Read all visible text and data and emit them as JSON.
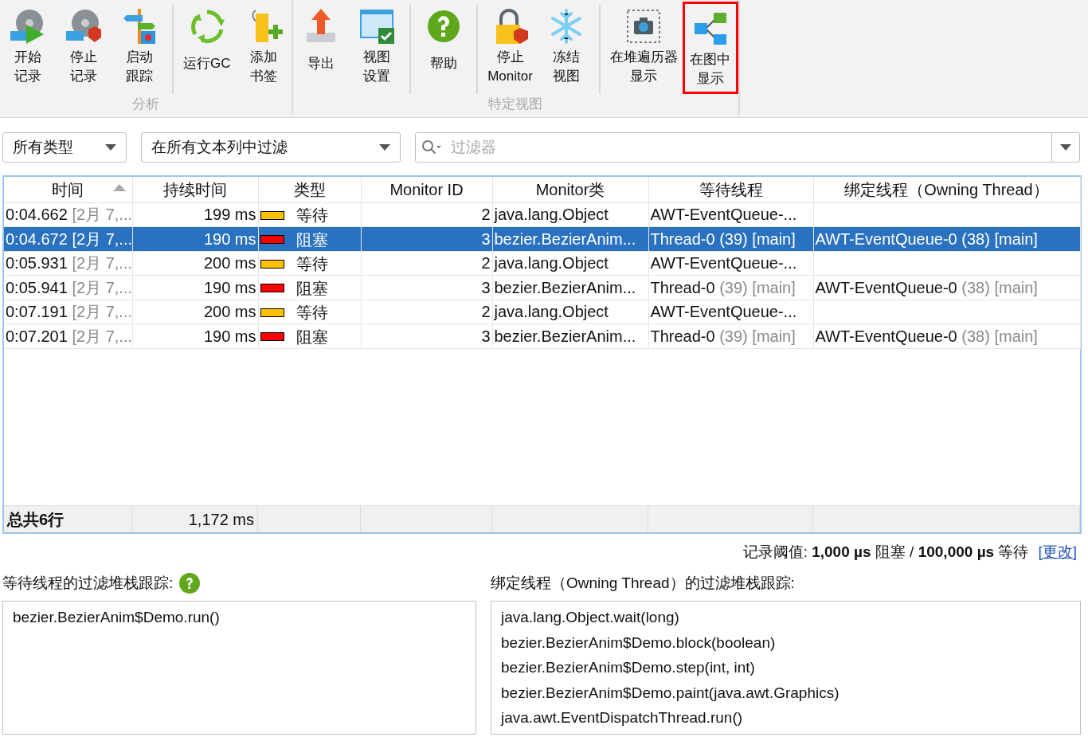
{
  "toolbar": {
    "groups": [
      {
        "label": "分析",
        "items": [
          {
            "kind": "button",
            "lines": [
              "开始",
              "记录"
            ],
            "highlighted": false
          },
          {
            "kind": "button",
            "lines": [
              "停止",
              "记录"
            ],
            "highlighted": false
          },
          {
            "kind": "button",
            "lines": [
              "启动",
              "跟踪"
            ],
            "highlighted": false
          },
          {
            "kind": "separator"
          },
          {
            "kind": "button",
            "lines": [
              "运行GC"
            ],
            "highlighted": false
          },
          {
            "kind": "button",
            "lines": [
              "添加",
              "书签"
            ],
            "highlighted": false
          }
        ]
      },
      {
        "label": "特定视图",
        "items": [
          {
            "kind": "button",
            "lines": [
              "导出"
            ],
            "highlighted": false
          },
          {
            "kind": "button",
            "lines": [
              "视图",
              "设置"
            ],
            "highlighted": false
          },
          {
            "kind": "separator"
          },
          {
            "kind": "button",
            "lines": [
              "帮助"
            ],
            "highlighted": false
          },
          {
            "kind": "separator"
          },
          {
            "kind": "button",
            "lines": [
              "停止",
              "Monitor"
            ],
            "highlighted": false
          },
          {
            "kind": "button",
            "lines": [
              "冻结",
              "视图"
            ],
            "highlighted": false
          },
          {
            "kind": "separator"
          },
          {
            "kind": "button",
            "lines": [
              "在堆遍历器",
              "显示"
            ],
            "highlighted": false
          },
          {
            "kind": "button",
            "lines": [
              "在图中",
              "显示"
            ],
            "highlighted": true
          }
        ]
      }
    ]
  },
  "filters": {
    "type_dropdown": "所有类型",
    "column_dropdown": "在所有文本列中过滤",
    "search": {
      "placeholder": "过滤器"
    }
  },
  "table": {
    "columns": [
      {
        "label": "时间",
        "sorted": true
      },
      {
        "label": "持续时间",
        "sorted": false
      },
      {
        "label": "类型",
        "sorted": false
      },
      {
        "label": "Monitor ID",
        "sorted": false
      },
      {
        "label": "Monitor类",
        "sorted": false
      },
      {
        "label": "等待线程",
        "sorted": false
      },
      {
        "label": "绑定线程（Owning Thread）",
        "sorted": false
      }
    ],
    "rows": [
      {
        "selected": false,
        "time": "0:04.662",
        "time_detail": "[2月 7,...",
        "duration": "199 ms",
        "type": "等待",
        "color": "#ffc000",
        "monitor_id": "2",
        "monitor_class": "java.lang.Object",
        "waiting_thread": "AWT-EventQueue-...",
        "waiting_detail": "",
        "owning_thread": "",
        "owning_detail": ""
      },
      {
        "selected": true,
        "time": "0:04.672",
        "time_detail": "[2月 7,...",
        "duration": "190 ms",
        "type": "阻塞",
        "color": "#ff0000",
        "monitor_id": "3",
        "monitor_class": "bezier.BezierAnim...",
        "waiting_thread": "Thread-0",
        "waiting_detail": "(39) [main]",
        "owning_thread": "AWT-EventQueue-0",
        "owning_detail": "(38) [main]"
      },
      {
        "selected": false,
        "time": "0:05.931",
        "time_detail": "[2月 7,...",
        "duration": "200 ms",
        "type": "等待",
        "color": "#ffc000",
        "monitor_id": "2",
        "monitor_class": "java.lang.Object",
        "waiting_thread": "AWT-EventQueue-...",
        "waiting_detail": "",
        "owning_thread": "",
        "owning_detail": ""
      },
      {
        "selected": false,
        "time": "0:05.941",
        "time_detail": "[2月 7,...",
        "duration": "190 ms",
        "type": "阻塞",
        "color": "#ff0000",
        "monitor_id": "3",
        "monitor_class": "bezier.BezierAnim...",
        "waiting_thread": "Thread-0",
        "waiting_detail": "(39) [main]",
        "owning_thread": "AWT-EventQueue-0",
        "owning_detail": "(38) [main]"
      },
      {
        "selected": false,
        "time": "0:07.191",
        "time_detail": "[2月 7,...",
        "duration": "200 ms",
        "type": "等待",
        "color": "#ffc000",
        "monitor_id": "2",
        "monitor_class": "java.lang.Object",
        "waiting_thread": "AWT-EventQueue-...",
        "waiting_detail": "",
        "owning_thread": "",
        "owning_detail": ""
      },
      {
        "selected": false,
        "time": "0:07.201",
        "time_detail": "[2月 7,...",
        "duration": "190 ms",
        "type": "阻塞",
        "color": "#ff0000",
        "monitor_id": "3",
        "monitor_class": "bezier.BezierAnim...",
        "waiting_thread": "Thread-0",
        "waiting_detail": "(39) [main]",
        "owning_thread": "AWT-EventQueue-0",
        "owning_detail": "(38) [main]"
      }
    ],
    "totals": {
      "label": "总共6行",
      "duration": "1,172 ms"
    }
  },
  "threshold": {
    "text": "记录阈值: **1,000 µs** 阻塞 / **100,000 µs** 等待",
    "link": "[更改]"
  },
  "waiting_stack": {
    "title": "等待线程的过滤堆栈跟踪:",
    "frames": [
      "bezier.BezierAnim$Demo.run()"
    ]
  },
  "owning_stack": {
    "title": "绑定线程（Owning Thread）的过滤堆栈跟踪:",
    "frames": [
      "java.lang.Object.wait(long)",
      "bezier.BezierAnim$Demo.block(boolean)",
      "bezier.BezierAnim$Demo.step(int, int)",
      "bezier.BezierAnim$Demo.paint(java.awt.Graphics)",
      "java.awt.EventDispatchThread.run()"
    ]
  }
}
